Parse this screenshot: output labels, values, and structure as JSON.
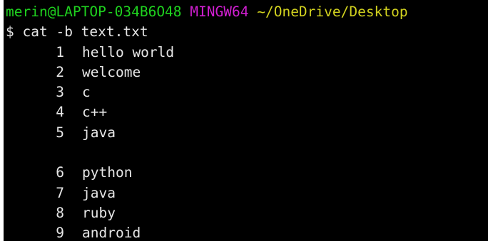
{
  "prompt": {
    "user_host": "merin@LAPTOP-034B6O48",
    "system": "MINGW64",
    "path": "~/OneDrive/Desktop"
  },
  "command": {
    "symbol": "$",
    "text": "cat -b text.txt"
  },
  "output": [
    {
      "num": "1",
      "text": "hello world"
    },
    {
      "num": "2",
      "text": "welcome"
    },
    {
      "num": "3",
      "text": "c"
    },
    {
      "num": "4",
      "text": "c++"
    },
    {
      "num": "5",
      "text": "java"
    },
    {
      "num": "",
      "text": ""
    },
    {
      "num": "6",
      "text": "python"
    },
    {
      "num": "7",
      "text": "java"
    },
    {
      "num": "8",
      "text": "ruby"
    },
    {
      "num": "9",
      "text": "android"
    }
  ],
  "colors": {
    "background": "#000000",
    "prompt_user": "#1fd21f",
    "prompt_system": "#d21fd2",
    "prompt_path": "#d2d21f",
    "text": "#e6e6e6"
  }
}
